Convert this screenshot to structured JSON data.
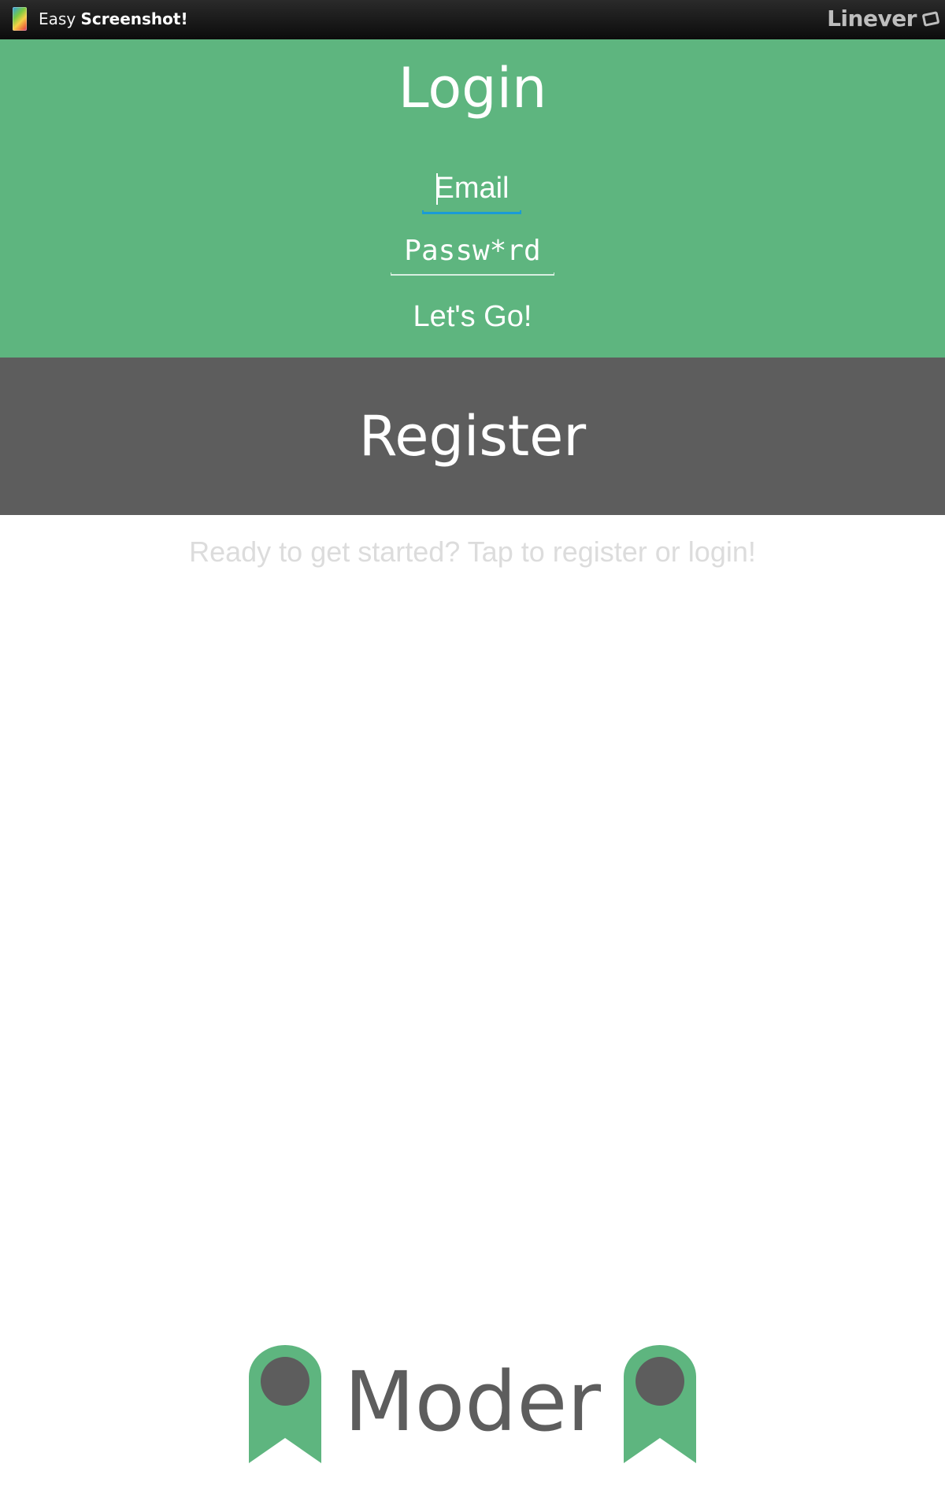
{
  "status_bar": {
    "app_title_light": "Easy",
    "app_title_bold": "Screenshot!",
    "brand": "Linever",
    "app_icon": "easy-screenshot-icon",
    "brand_icon": "linever-logo-icon"
  },
  "login": {
    "title": "Login",
    "email_placeholder": "Email",
    "password_placeholder": "Passw*rd",
    "submit_label": "Let's Go!",
    "background": "#5eb57f",
    "focus_color": "#1a9bd7"
  },
  "register": {
    "title": "Register",
    "background": "#5d5d5d"
  },
  "hint": "Ready to get started? Tap to register or login!",
  "logo": {
    "word": "Moder",
    "icon": "bookmark-ribbon-icon",
    "ribbon_color": "#5eb57f",
    "dot_color": "#5d5d5d"
  }
}
